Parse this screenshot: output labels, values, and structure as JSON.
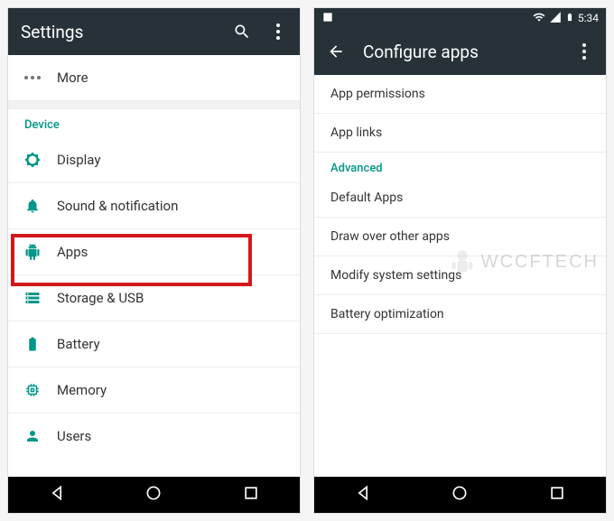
{
  "left": {
    "title": "Settings",
    "rows": {
      "more": "More",
      "device_header": "Device",
      "display": "Display",
      "sound": "Sound & notification",
      "apps": "Apps",
      "storage": "Storage & USB",
      "battery": "Battery",
      "memory": "Memory",
      "users": "Users"
    }
  },
  "right": {
    "status_time": "5:34",
    "title": "Configure apps",
    "items": {
      "app_permissions": "App permissions",
      "app_links": "App links",
      "advanced_header": "Advanced",
      "default_apps": "Default Apps",
      "draw_over": "Draw over other apps",
      "modify_system": "Modify system settings",
      "battery_opt": "Battery optimization"
    }
  },
  "watermark": "WCCFTECH"
}
